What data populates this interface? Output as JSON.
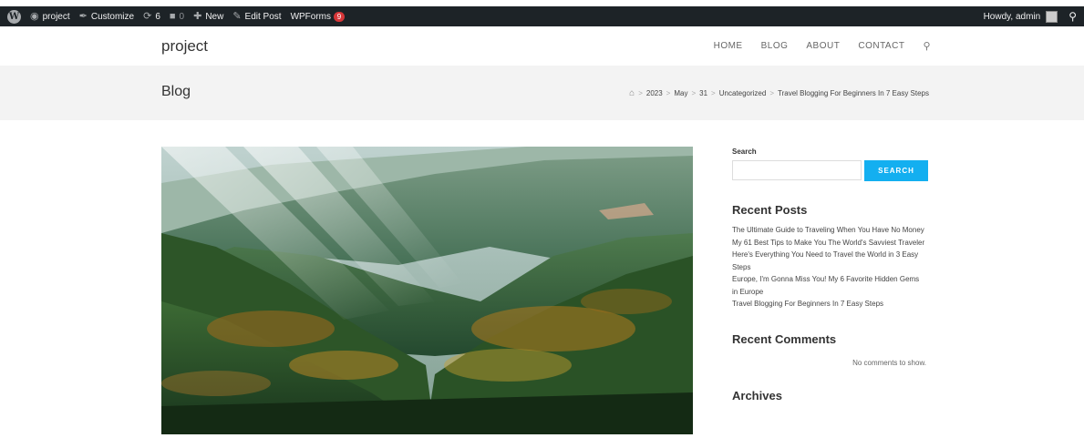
{
  "admin_bar": {
    "wp_logo": "W",
    "site_name": "project",
    "customize": "Customize",
    "updates_count": "6",
    "comments_count": "0",
    "new_label": "New",
    "edit_post": "Edit Post",
    "wpforms": "WPForms",
    "wpforms_badge": "9",
    "howdy": "Howdy, admin"
  },
  "header": {
    "site_title": "project",
    "nav": [
      "HOME",
      "BLOG",
      "ABOUT",
      "CONTACT"
    ]
  },
  "page_header": {
    "title": "Blog",
    "breadcrumb": [
      "2023",
      "May",
      "31",
      "Uncategorized",
      "Travel Blogging For Beginners In 7 Easy Steps"
    ]
  },
  "sidebar": {
    "search_label": "Search",
    "search_button": "SEARCH",
    "recent_posts_title": "Recent Posts",
    "recent_posts": [
      "The Ultimate Guide to Traveling When You Have No Money",
      "My 61 Best Tips to Make You The World's Savviest Traveler",
      "Here's Everything You Need to Travel the World in 3 Easy Steps",
      "Europe, I'm Gonna Miss You! My 6 Favorite Hidden Gems in Europe",
      "Travel Blogging For Beginners In 7 Easy Steps"
    ],
    "recent_comments_title": "Recent Comments",
    "no_comments": "No comments to show.",
    "archives_title": "Archives"
  },
  "colors": {
    "admin_bar_bg": "#1d2327",
    "accent": "#13aff0",
    "badge": "#d63638",
    "page_header_bg": "#f3f3f3"
  },
  "icons": [
    "wordpress-logo-icon",
    "dashboard-icon",
    "brush-icon",
    "updates-icon",
    "comment-icon",
    "plus-icon",
    "pencil-icon",
    "search-icon",
    "home-icon"
  ]
}
